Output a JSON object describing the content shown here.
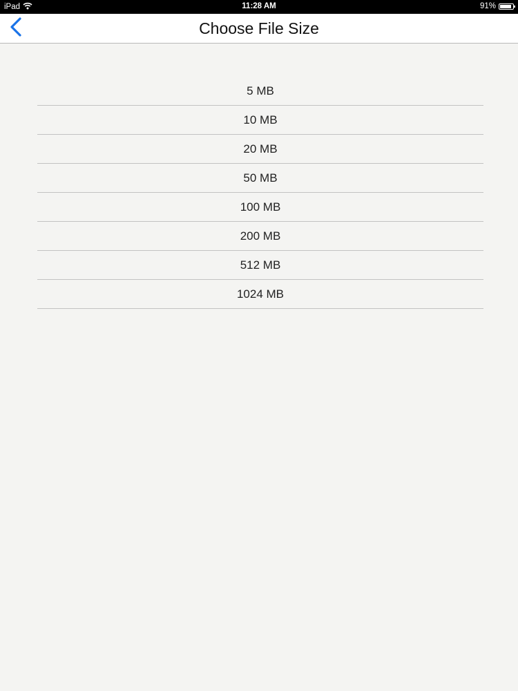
{
  "status_bar": {
    "device": "iPad",
    "time": "11:28 AM",
    "battery": "91%",
    "battery_level": 0.91,
    "icons": [
      "wifi-icon",
      "battery-icon"
    ]
  },
  "nav": {
    "title": "Choose File Size",
    "back_icon": "chevron-left-icon",
    "accent_color": "#1a73e8"
  },
  "sizes": [
    "5 MB",
    "10 MB",
    "20 MB",
    "50 MB",
    "100 MB",
    "200 MB",
    "512 MB",
    "1024 MB"
  ]
}
